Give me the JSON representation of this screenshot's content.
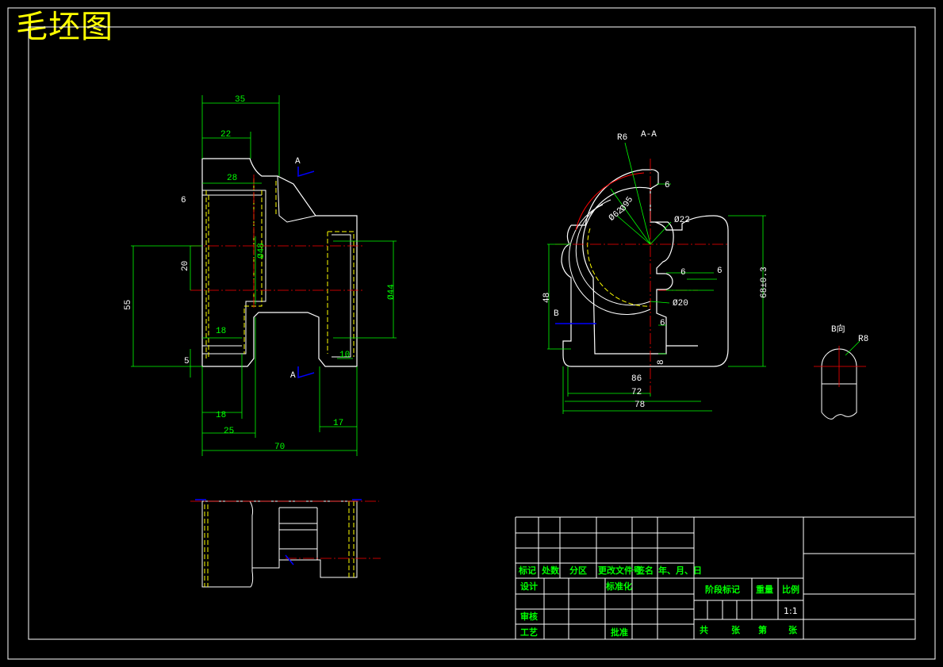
{
  "title": "毛坯图",
  "colors": {
    "background": "#000000",
    "outline": "#ffffff",
    "dimension": "#00ff00",
    "center_line": "#ff0000",
    "hidden": "#ffff00",
    "cut_marker": "#0000ff"
  },
  "front_view": {
    "dims": {
      "d35": "35",
      "d22": "22",
      "d28": "28",
      "d6": "6",
      "d20": "20",
      "d55": "55",
      "d48": "Ø48",
      "d44": "Ø44",
      "d18a": "18",
      "d10": "10",
      "d5": "5",
      "d18b": "18",
      "d25": "25",
      "d17": "17",
      "d70": "70"
    },
    "section_a_top": "A",
    "section_a_bottom": "A"
  },
  "section_view": {
    "label": "A-A",
    "dims": {
      "r6": "R6",
      "d6a": "6",
      "d95": "Ø95",
      "d62": "Ø62",
      "d22": "Ø22",
      "d6b": "6",
      "d6c": "6",
      "d20": "Ø20",
      "d6d": "6",
      "d68": "68±0.3",
      "d48": "48",
      "d8": "8",
      "d86": "86",
      "d72": "72",
      "d78": "78"
    },
    "section_b": "B"
  },
  "detail_view": {
    "label": "B向",
    "dim": "R8"
  },
  "title_block": {
    "headers": [
      "标记",
      "处数",
      "分区",
      "更改文件号",
      "签名",
      "年、月、日"
    ],
    "design": "设计",
    "standardize": "标准化",
    "review": "审核",
    "process": "工艺",
    "approve": "批准",
    "stage_mark": "阶段标记",
    "weight": "重量",
    "scale_label": "比例",
    "scale": "1:1",
    "total": "共",
    "sheets": "张",
    "nth": "第",
    "sheet": "张"
  }
}
